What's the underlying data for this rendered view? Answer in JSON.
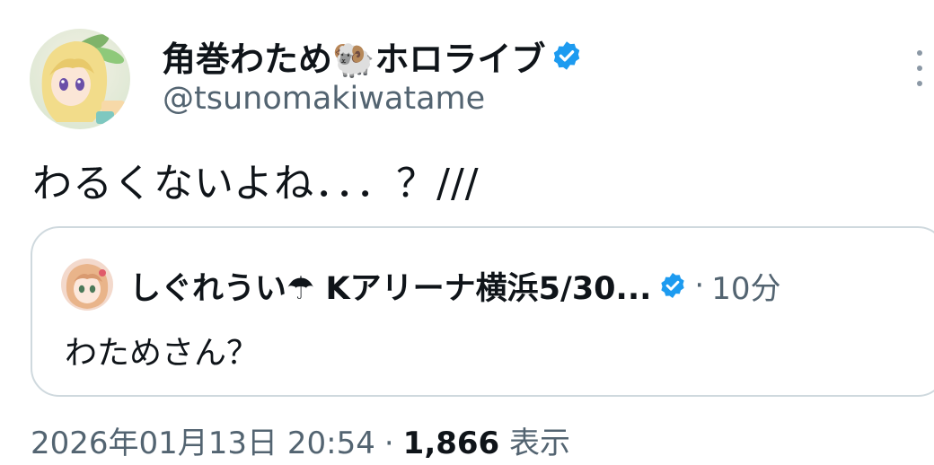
{
  "author": {
    "name": "角巻わため🐏ホロライブ",
    "handle": "@tsunomakiwatame",
    "verified": true
  },
  "tweet": {
    "text": "わるくないよね．．．？///"
  },
  "quote": {
    "author_name": "しぐれうい☂ Kアリーナ横浜5/30...",
    "separator": "·",
    "time_ago": "10分",
    "text": "わためさん？",
    "verified": true
  },
  "footer": {
    "timestamp": "2026年01月13日 20:54",
    "separator": "·",
    "views_count": "1,866",
    "views_label": "表示"
  },
  "colors": {
    "text_primary": "#0f1419",
    "text_secondary": "#536471",
    "verified_blue": "#1d9bf0",
    "border": "#cfd9de"
  },
  "icons": {
    "verified": "verified-badge-icon",
    "more": "more-options-icon"
  }
}
